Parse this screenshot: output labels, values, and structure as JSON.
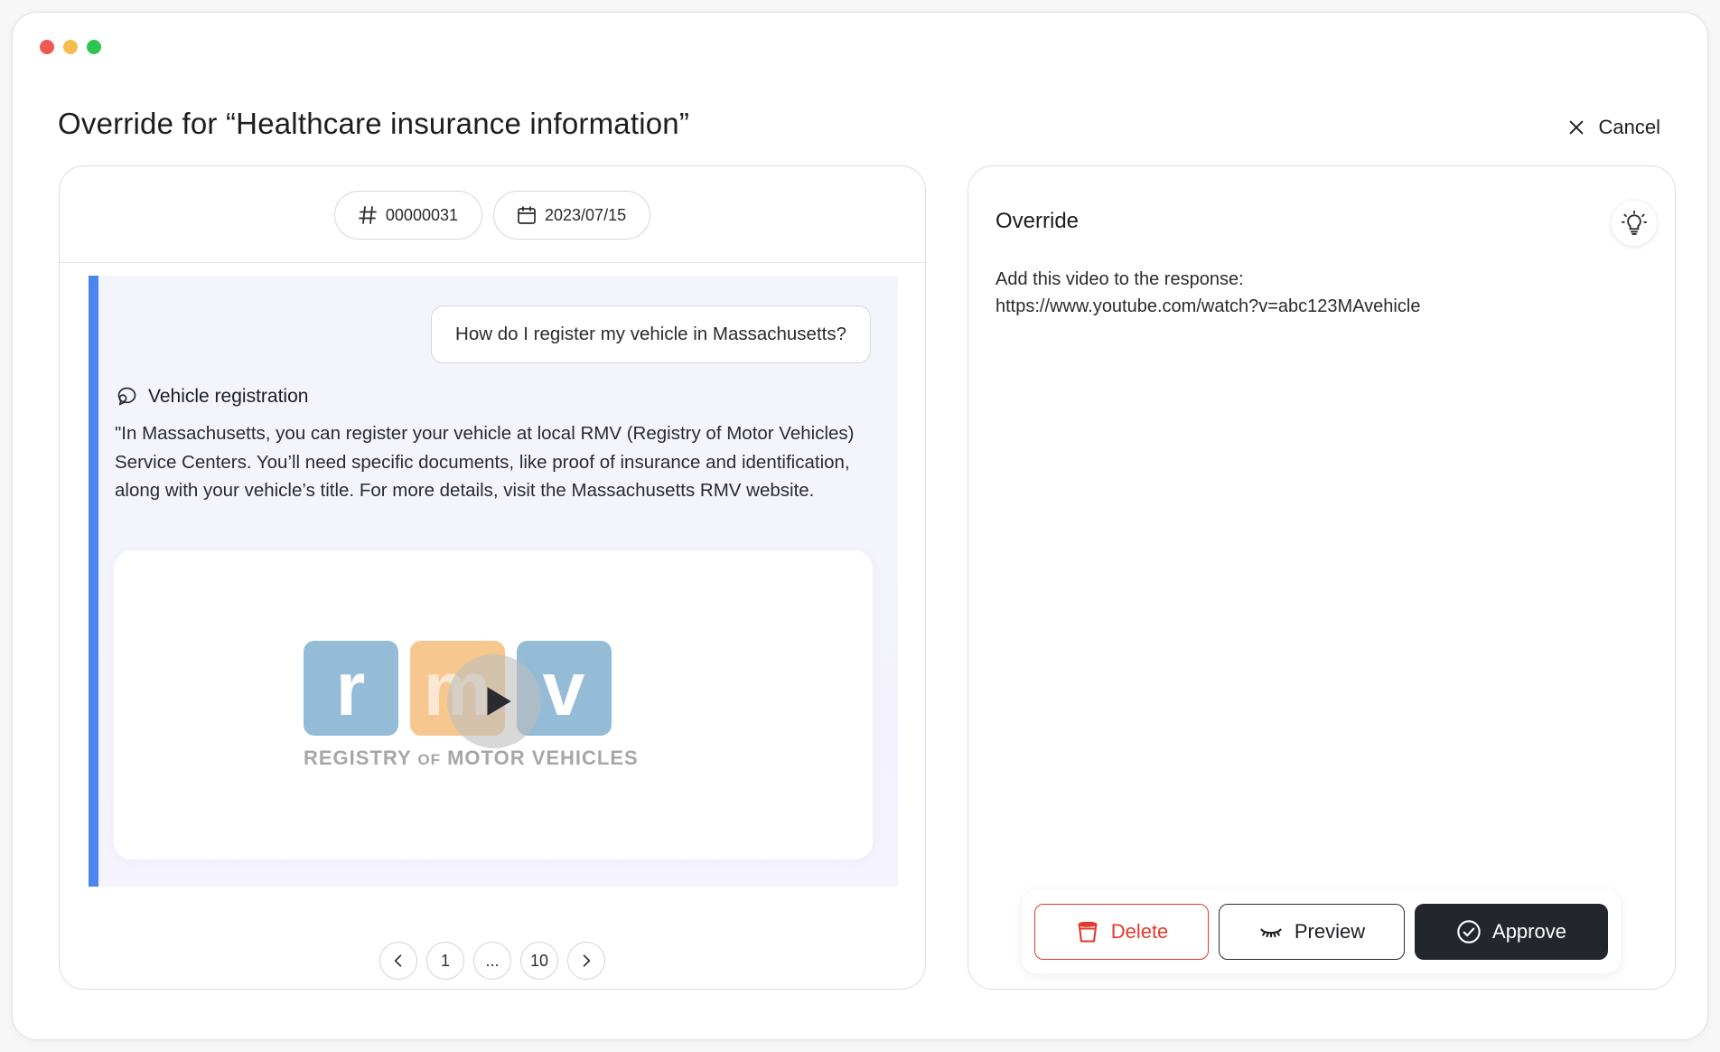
{
  "window": {
    "title": "Override for “Healthcare insurance information”",
    "cancel_label": "Cancel"
  },
  "conversation": {
    "id": "00000031",
    "date": "2023/07/15",
    "user_message": "How do I register my vehicle in Massachusetts?",
    "bot_topic": "Vehicle registration",
    "bot_answer": "\"In Massachusetts, you can register your vehicle at local RMV (Registry of Motor Vehicles) Service Centers. You’ll need specific documents, like proof of insurance and identification, along with your vehicle’s title. For more details, visit the Massachusetts RMV website.",
    "video": {
      "logo_letters": [
        "r",
        "m",
        "v"
      ],
      "logo_caption_a": "REGISTRY",
      "logo_caption_of": "OF",
      "logo_caption_b": "MOTOR VEHICLES"
    }
  },
  "pagination": {
    "first": "1",
    "ellipsis": "...",
    "last": "10"
  },
  "override": {
    "heading": "Override",
    "line1": "Add this video to the response:",
    "line2": "https://www.youtube.com/watch?v=abc123MAvehicle"
  },
  "actions": {
    "delete_label": "Delete",
    "preview_label": "Preview",
    "approve_label": "Approve"
  },
  "colors": {
    "accent_blue": "#4a86f2",
    "danger": "#e03a2c",
    "dark_button": "#24262d",
    "rmv_blue": "#94bcd6",
    "rmv_orange": "#f6c78f"
  },
  "icons": [
    "hash-icon",
    "calendar-icon",
    "chat-bubble-icon",
    "play-icon",
    "chevron-left-icon",
    "chevron-right-icon",
    "lightbulb-icon",
    "close-icon",
    "trash-icon",
    "eye-closed-icon",
    "check-circle-icon"
  ]
}
